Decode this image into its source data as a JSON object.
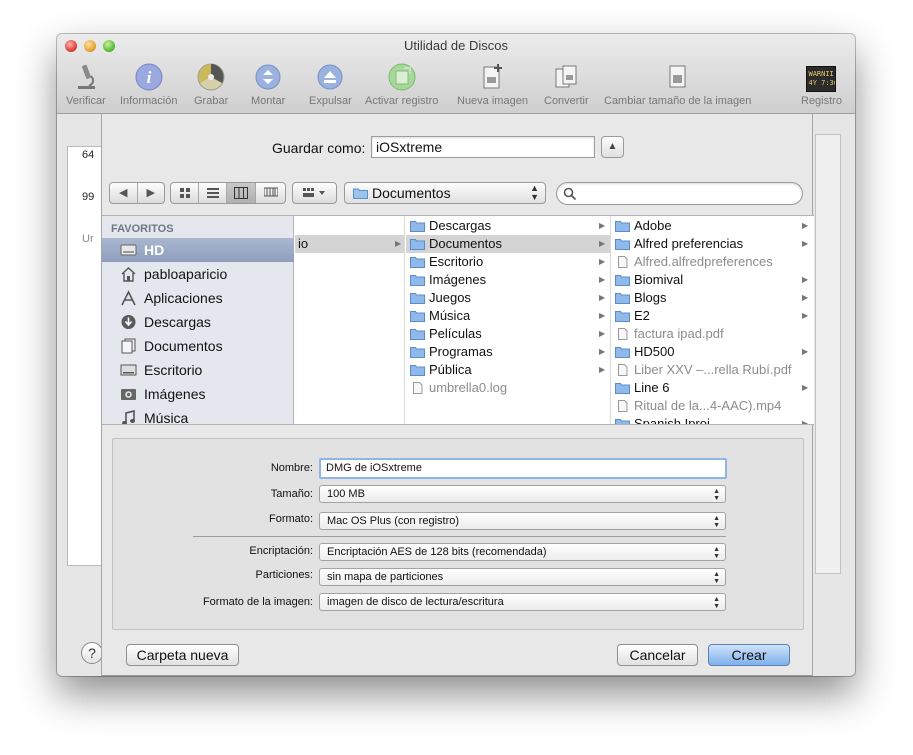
{
  "window": {
    "title": "Utilidad de Discos"
  },
  "toolbar": {
    "items": [
      {
        "label": "Verificar",
        "icon": "microscope-icon"
      },
      {
        "label": "Información",
        "icon": "info-icon"
      },
      {
        "label": "Grabar",
        "icon": "burn-icon"
      },
      {
        "label": "Montar",
        "icon": "mount-icon"
      },
      {
        "label": "Expulsar",
        "icon": "eject-icon"
      },
      {
        "label": "Activar registro",
        "icon": "journal-icon"
      },
      {
        "label": "Nueva imagen",
        "icon": "new-image-icon"
      },
      {
        "label": "Convertir",
        "icon": "convert-icon"
      },
      {
        "label": "Cambiar tamaño de la imagen",
        "icon": "resize-icon"
      },
      {
        "label": "Registro",
        "icon": "log-icon"
      }
    ],
    "log_icon_text": "WARNII\n4Y 7:36"
  },
  "background": {
    "disk_items": [
      "64",
      "99",
      "Ur"
    ],
    "help_label": "?"
  },
  "save": {
    "label": "Guardar como:",
    "value": "iOSxtreme",
    "expand_label": "▲"
  },
  "nav": {
    "back": "◀",
    "forward": "▶",
    "location": "Documentos",
    "search_placeholder": ""
  },
  "sidebar": {
    "heading": "FAVORITOS",
    "items": [
      {
        "label": "HD",
        "icon": "hard-drive-icon",
        "selected": true
      },
      {
        "label": "pabloaparicio",
        "icon": "home-icon"
      },
      {
        "label": "Aplicaciones",
        "icon": "applications-icon"
      },
      {
        "label": "Descargas",
        "icon": "downloads-icon"
      },
      {
        "label": "Documentos",
        "icon": "documents-icon"
      },
      {
        "label": "Escritorio",
        "icon": "desktop-icon"
      },
      {
        "label": "Imágenes",
        "icon": "pictures-icon"
      },
      {
        "label": "Música",
        "icon": "music-icon"
      }
    ]
  },
  "columns": {
    "col1": [
      {
        "label": "io",
        "selected": true,
        "has_children": true
      }
    ],
    "col2": [
      {
        "label": "Descargas",
        "type": "folder",
        "has_children": true
      },
      {
        "label": "Documentos",
        "type": "folder",
        "selected": true,
        "has_children": true
      },
      {
        "label": "Escritorio",
        "type": "folder",
        "has_children": true
      },
      {
        "label": "Imágenes",
        "type": "folder",
        "has_children": true
      },
      {
        "label": "Juegos",
        "type": "folder",
        "has_children": true
      },
      {
        "label": "Música",
        "type": "folder",
        "has_children": true
      },
      {
        "label": "Películas",
        "type": "folder",
        "has_children": true
      },
      {
        "label": "Programas",
        "type": "folder",
        "has_children": true
      },
      {
        "label": "Pública",
        "type": "folder",
        "has_children": true
      },
      {
        "label": "umbrella0.log",
        "type": "file",
        "dim": true
      }
    ],
    "col3": [
      {
        "label": "Adobe",
        "type": "folder",
        "has_children": true
      },
      {
        "label": "Alfred preferencias",
        "type": "folder",
        "has_children": true
      },
      {
        "label": "Alfred.alfredpreferences",
        "type": "file",
        "dim": true
      },
      {
        "label": "Biomival",
        "type": "folder",
        "has_children": true
      },
      {
        "label": "Blogs",
        "type": "folder",
        "has_children": true
      },
      {
        "label": "E2",
        "type": "folder",
        "has_children": true
      },
      {
        "label": "factura ipad.pdf",
        "type": "file",
        "dim": true
      },
      {
        "label": "HD500",
        "type": "folder",
        "has_children": true
      },
      {
        "label": "Liber XXV –...rella Rubí.pdf",
        "type": "file",
        "dim": true
      },
      {
        "label": "Line 6",
        "type": "folder",
        "has_children": true
      },
      {
        "label": "Ritual de la...4-AAC).mp4",
        "type": "file",
        "dim": true
      },
      {
        "label": "Spanish Iproi",
        "type": "folder",
        "has_children": true
      }
    ]
  },
  "options": {
    "name_label": "Nombre:",
    "name_value": "DMG de iOSxtreme",
    "size_label": "Tamaño:",
    "size_value": "100 MB",
    "format_label": "Formato:",
    "format_value": "Mac OS Plus (con registro)",
    "encryption_label": "Encriptación:",
    "encryption_value": "Encriptación AES de 128 bits (recomendada)",
    "partitions_label": "Particiones:",
    "partitions_value": "sin mapa de particiones",
    "image_format_label": "Formato de la imagen:",
    "image_format_value": "imagen de disco de lectura/escritura"
  },
  "buttons": {
    "new_folder": "Carpeta nueva",
    "cancel": "Cancelar",
    "create": "Crear"
  },
  "colors": {
    "sidebar_selection": "#8e9fbd",
    "default_button": "#7fb0ec",
    "folder": "#6f9fd8"
  }
}
